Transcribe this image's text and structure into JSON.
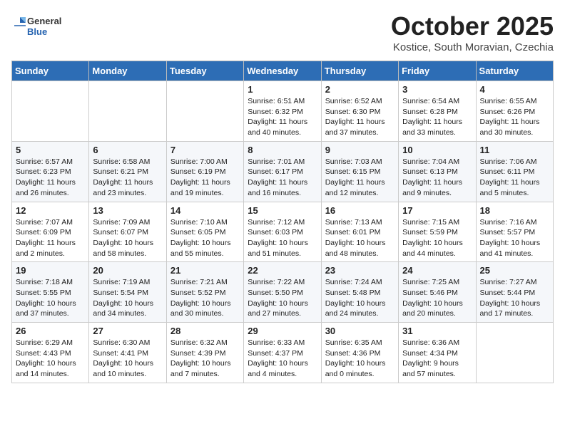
{
  "header": {
    "logo_general": "General",
    "logo_blue": "Blue",
    "month_title": "October 2025",
    "location": "Kostice, South Moravian, Czechia"
  },
  "weekdays": [
    "Sunday",
    "Monday",
    "Tuesday",
    "Wednesday",
    "Thursday",
    "Friday",
    "Saturday"
  ],
  "weeks": [
    [
      {
        "day": "",
        "info": ""
      },
      {
        "day": "",
        "info": ""
      },
      {
        "day": "",
        "info": ""
      },
      {
        "day": "1",
        "info": "Sunrise: 6:51 AM\nSunset: 6:32 PM\nDaylight: 11 hours\nand 40 minutes."
      },
      {
        "day": "2",
        "info": "Sunrise: 6:52 AM\nSunset: 6:30 PM\nDaylight: 11 hours\nand 37 minutes."
      },
      {
        "day": "3",
        "info": "Sunrise: 6:54 AM\nSunset: 6:28 PM\nDaylight: 11 hours\nand 33 minutes."
      },
      {
        "day": "4",
        "info": "Sunrise: 6:55 AM\nSunset: 6:26 PM\nDaylight: 11 hours\nand 30 minutes."
      }
    ],
    [
      {
        "day": "5",
        "info": "Sunrise: 6:57 AM\nSunset: 6:23 PM\nDaylight: 11 hours\nand 26 minutes."
      },
      {
        "day": "6",
        "info": "Sunrise: 6:58 AM\nSunset: 6:21 PM\nDaylight: 11 hours\nand 23 minutes."
      },
      {
        "day": "7",
        "info": "Sunrise: 7:00 AM\nSunset: 6:19 PM\nDaylight: 11 hours\nand 19 minutes."
      },
      {
        "day": "8",
        "info": "Sunrise: 7:01 AM\nSunset: 6:17 PM\nDaylight: 11 hours\nand 16 minutes."
      },
      {
        "day": "9",
        "info": "Sunrise: 7:03 AM\nSunset: 6:15 PM\nDaylight: 11 hours\nand 12 minutes."
      },
      {
        "day": "10",
        "info": "Sunrise: 7:04 AM\nSunset: 6:13 PM\nDaylight: 11 hours\nand 9 minutes."
      },
      {
        "day": "11",
        "info": "Sunrise: 7:06 AM\nSunset: 6:11 PM\nDaylight: 11 hours\nand 5 minutes."
      }
    ],
    [
      {
        "day": "12",
        "info": "Sunrise: 7:07 AM\nSunset: 6:09 PM\nDaylight: 11 hours\nand 2 minutes."
      },
      {
        "day": "13",
        "info": "Sunrise: 7:09 AM\nSunset: 6:07 PM\nDaylight: 10 hours\nand 58 minutes."
      },
      {
        "day": "14",
        "info": "Sunrise: 7:10 AM\nSunset: 6:05 PM\nDaylight: 10 hours\nand 55 minutes."
      },
      {
        "day": "15",
        "info": "Sunrise: 7:12 AM\nSunset: 6:03 PM\nDaylight: 10 hours\nand 51 minutes."
      },
      {
        "day": "16",
        "info": "Sunrise: 7:13 AM\nSunset: 6:01 PM\nDaylight: 10 hours\nand 48 minutes."
      },
      {
        "day": "17",
        "info": "Sunrise: 7:15 AM\nSunset: 5:59 PM\nDaylight: 10 hours\nand 44 minutes."
      },
      {
        "day": "18",
        "info": "Sunrise: 7:16 AM\nSunset: 5:57 PM\nDaylight: 10 hours\nand 41 minutes."
      }
    ],
    [
      {
        "day": "19",
        "info": "Sunrise: 7:18 AM\nSunset: 5:55 PM\nDaylight: 10 hours\nand 37 minutes."
      },
      {
        "day": "20",
        "info": "Sunrise: 7:19 AM\nSunset: 5:54 PM\nDaylight: 10 hours\nand 34 minutes."
      },
      {
        "day": "21",
        "info": "Sunrise: 7:21 AM\nSunset: 5:52 PM\nDaylight: 10 hours\nand 30 minutes."
      },
      {
        "day": "22",
        "info": "Sunrise: 7:22 AM\nSunset: 5:50 PM\nDaylight: 10 hours\nand 27 minutes."
      },
      {
        "day": "23",
        "info": "Sunrise: 7:24 AM\nSunset: 5:48 PM\nDaylight: 10 hours\nand 24 minutes."
      },
      {
        "day": "24",
        "info": "Sunrise: 7:25 AM\nSunset: 5:46 PM\nDaylight: 10 hours\nand 20 minutes."
      },
      {
        "day": "25",
        "info": "Sunrise: 7:27 AM\nSunset: 5:44 PM\nDaylight: 10 hours\nand 17 minutes."
      }
    ],
    [
      {
        "day": "26",
        "info": "Sunrise: 6:29 AM\nSunset: 4:43 PM\nDaylight: 10 hours\nand 14 minutes."
      },
      {
        "day": "27",
        "info": "Sunrise: 6:30 AM\nSunset: 4:41 PM\nDaylight: 10 hours\nand 10 minutes."
      },
      {
        "day": "28",
        "info": "Sunrise: 6:32 AM\nSunset: 4:39 PM\nDaylight: 10 hours\nand 7 minutes."
      },
      {
        "day": "29",
        "info": "Sunrise: 6:33 AM\nSunset: 4:37 PM\nDaylight: 10 hours\nand 4 minutes."
      },
      {
        "day": "30",
        "info": "Sunrise: 6:35 AM\nSunset: 4:36 PM\nDaylight: 10 hours\nand 0 minutes."
      },
      {
        "day": "31",
        "info": "Sunrise: 6:36 AM\nSunset: 4:34 PM\nDaylight: 9 hours\nand 57 minutes."
      },
      {
        "day": "",
        "info": ""
      }
    ]
  ]
}
